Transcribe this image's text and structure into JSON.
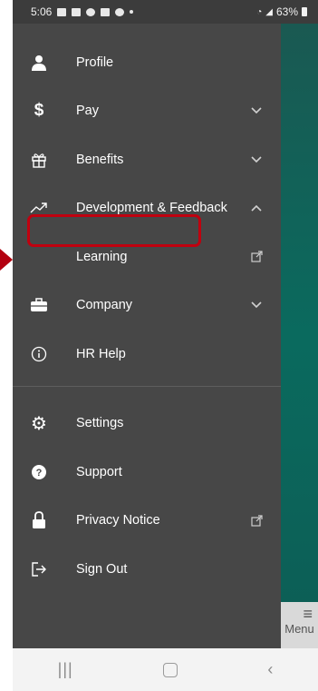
{
  "status": {
    "time": "5:06",
    "battery": "63%"
  },
  "menu": {
    "items": [
      {
        "label": "Profile",
        "icon": "person-icon"
      },
      {
        "label": "Pay",
        "icon": "dollar-icon",
        "trail": "chevron-down-icon"
      },
      {
        "label": "Benefits",
        "icon": "gift-icon",
        "trail": "chevron-down-icon"
      },
      {
        "label": "Development & Feedback",
        "icon": "trend-up-icon",
        "trail": "chevron-up-icon"
      },
      {
        "label": "Learning",
        "trail": "external-link-icon",
        "highlighted": true
      },
      {
        "label": "Company",
        "icon": "briefcase-icon",
        "trail": "chevron-down-icon"
      },
      {
        "label": "HR Help",
        "icon": "info-icon"
      }
    ],
    "secondary": [
      {
        "label": "Settings",
        "icon": "gear-icon"
      },
      {
        "label": "Support",
        "icon": "question-icon"
      },
      {
        "label": "Privacy Notice",
        "icon": "lock-icon",
        "trail": "external-link-icon"
      },
      {
        "label": "Sign Out",
        "icon": "sign-out-icon"
      }
    ]
  },
  "menu_tab": {
    "label": "Menu"
  },
  "colors": {
    "drawer_bg": "#474747",
    "highlight_border": "#c0000f",
    "backdrop": "#0a6a5e"
  }
}
